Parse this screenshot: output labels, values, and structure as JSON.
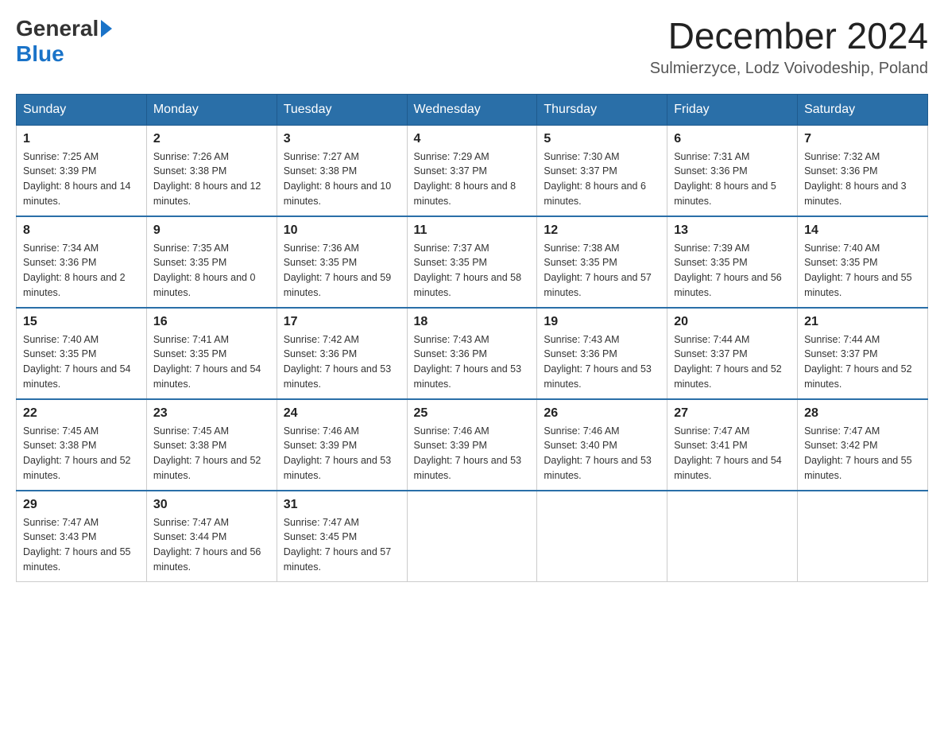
{
  "header": {
    "logo_general": "General",
    "logo_blue": "Blue",
    "month_title": "December 2024",
    "subtitle": "Sulmierzyce, Lodz Voivodeship, Poland"
  },
  "weekdays": [
    "Sunday",
    "Monday",
    "Tuesday",
    "Wednesday",
    "Thursday",
    "Friday",
    "Saturday"
  ],
  "weeks": [
    [
      {
        "day": "1",
        "sunrise": "7:25 AM",
        "sunset": "3:39 PM",
        "daylight": "8 hours and 14 minutes."
      },
      {
        "day": "2",
        "sunrise": "7:26 AM",
        "sunset": "3:38 PM",
        "daylight": "8 hours and 12 minutes."
      },
      {
        "day": "3",
        "sunrise": "7:27 AM",
        "sunset": "3:38 PM",
        "daylight": "8 hours and 10 minutes."
      },
      {
        "day": "4",
        "sunrise": "7:29 AM",
        "sunset": "3:37 PM",
        "daylight": "8 hours and 8 minutes."
      },
      {
        "day": "5",
        "sunrise": "7:30 AM",
        "sunset": "3:37 PM",
        "daylight": "8 hours and 6 minutes."
      },
      {
        "day": "6",
        "sunrise": "7:31 AM",
        "sunset": "3:36 PM",
        "daylight": "8 hours and 5 minutes."
      },
      {
        "day": "7",
        "sunrise": "7:32 AM",
        "sunset": "3:36 PM",
        "daylight": "8 hours and 3 minutes."
      }
    ],
    [
      {
        "day": "8",
        "sunrise": "7:34 AM",
        "sunset": "3:36 PM",
        "daylight": "8 hours and 2 minutes."
      },
      {
        "day": "9",
        "sunrise": "7:35 AM",
        "sunset": "3:35 PM",
        "daylight": "8 hours and 0 minutes."
      },
      {
        "day": "10",
        "sunrise": "7:36 AM",
        "sunset": "3:35 PM",
        "daylight": "7 hours and 59 minutes."
      },
      {
        "day": "11",
        "sunrise": "7:37 AM",
        "sunset": "3:35 PM",
        "daylight": "7 hours and 58 minutes."
      },
      {
        "day": "12",
        "sunrise": "7:38 AM",
        "sunset": "3:35 PM",
        "daylight": "7 hours and 57 minutes."
      },
      {
        "day": "13",
        "sunrise": "7:39 AM",
        "sunset": "3:35 PM",
        "daylight": "7 hours and 56 minutes."
      },
      {
        "day": "14",
        "sunrise": "7:40 AM",
        "sunset": "3:35 PM",
        "daylight": "7 hours and 55 minutes."
      }
    ],
    [
      {
        "day": "15",
        "sunrise": "7:40 AM",
        "sunset": "3:35 PM",
        "daylight": "7 hours and 54 minutes."
      },
      {
        "day": "16",
        "sunrise": "7:41 AM",
        "sunset": "3:35 PM",
        "daylight": "7 hours and 54 minutes."
      },
      {
        "day": "17",
        "sunrise": "7:42 AM",
        "sunset": "3:36 PM",
        "daylight": "7 hours and 53 minutes."
      },
      {
        "day": "18",
        "sunrise": "7:43 AM",
        "sunset": "3:36 PM",
        "daylight": "7 hours and 53 minutes."
      },
      {
        "day": "19",
        "sunrise": "7:43 AM",
        "sunset": "3:36 PM",
        "daylight": "7 hours and 53 minutes."
      },
      {
        "day": "20",
        "sunrise": "7:44 AM",
        "sunset": "3:37 PM",
        "daylight": "7 hours and 52 minutes."
      },
      {
        "day": "21",
        "sunrise": "7:44 AM",
        "sunset": "3:37 PM",
        "daylight": "7 hours and 52 minutes."
      }
    ],
    [
      {
        "day": "22",
        "sunrise": "7:45 AM",
        "sunset": "3:38 PM",
        "daylight": "7 hours and 52 minutes."
      },
      {
        "day": "23",
        "sunrise": "7:45 AM",
        "sunset": "3:38 PM",
        "daylight": "7 hours and 52 minutes."
      },
      {
        "day": "24",
        "sunrise": "7:46 AM",
        "sunset": "3:39 PM",
        "daylight": "7 hours and 53 minutes."
      },
      {
        "day": "25",
        "sunrise": "7:46 AM",
        "sunset": "3:39 PM",
        "daylight": "7 hours and 53 minutes."
      },
      {
        "day": "26",
        "sunrise": "7:46 AM",
        "sunset": "3:40 PM",
        "daylight": "7 hours and 53 minutes."
      },
      {
        "day": "27",
        "sunrise": "7:47 AM",
        "sunset": "3:41 PM",
        "daylight": "7 hours and 54 minutes."
      },
      {
        "day": "28",
        "sunrise": "7:47 AM",
        "sunset": "3:42 PM",
        "daylight": "7 hours and 55 minutes."
      }
    ],
    [
      {
        "day": "29",
        "sunrise": "7:47 AM",
        "sunset": "3:43 PM",
        "daylight": "7 hours and 55 minutes."
      },
      {
        "day": "30",
        "sunrise": "7:47 AM",
        "sunset": "3:44 PM",
        "daylight": "7 hours and 56 minutes."
      },
      {
        "day": "31",
        "sunrise": "7:47 AM",
        "sunset": "3:45 PM",
        "daylight": "7 hours and 57 minutes."
      },
      null,
      null,
      null,
      null
    ]
  ]
}
